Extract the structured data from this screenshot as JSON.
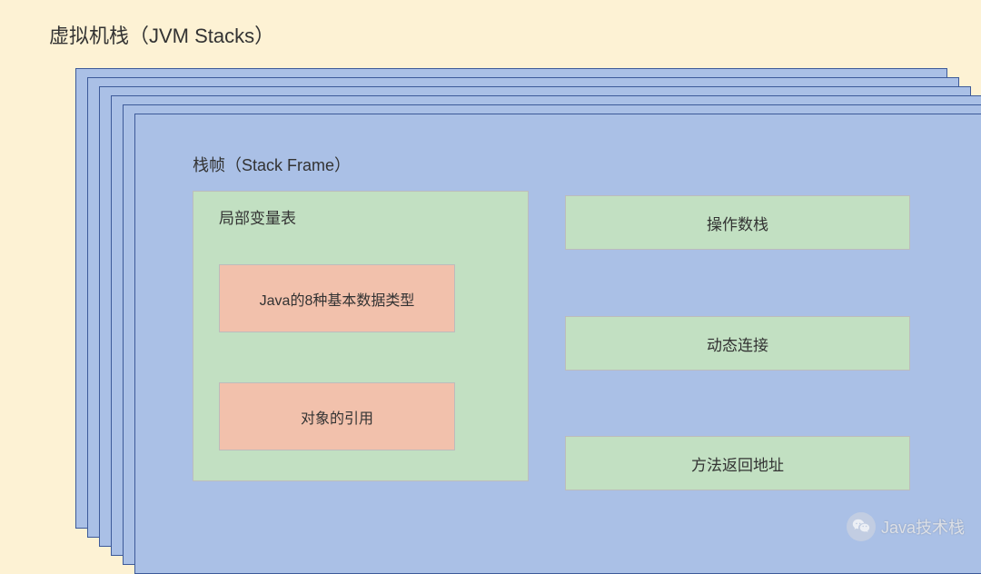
{
  "title": "虚拟机栈（JVM Stacks）",
  "stackFrame": {
    "title": "栈帧（Stack Frame）",
    "localVars": {
      "title": "局部变量表",
      "items": [
        "Java的8种基本数据类型",
        "对象的引用"
      ]
    },
    "right": {
      "operandStack": "操作数栈",
      "dynamicLinking": "动态连接",
      "returnAddress": "方法返回地址"
    }
  },
  "watermark": {
    "text": "Java技术栈",
    "icon": "wechat-icon"
  }
}
